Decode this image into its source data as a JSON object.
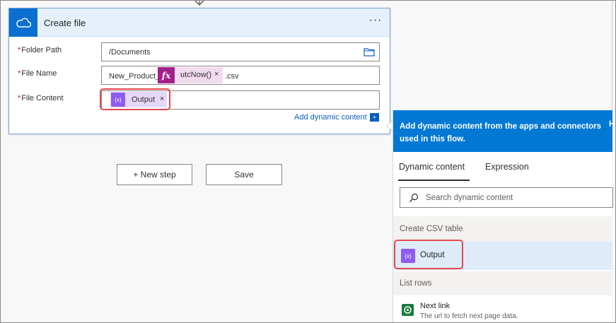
{
  "card": {
    "title": "Create file",
    "more": "···",
    "folder_label": "Folder Path",
    "folder_value": "/Documents",
    "filename_label": "File Name",
    "filename_prefix": "New_Product_",
    "filename_fx": "fx",
    "filename_token": "utcNow()",
    "filename_suffix": ".csv",
    "content_label": "File Content",
    "content_token": "Output",
    "token_close": "×",
    "required_mark": "*",
    "add_dynamic": "Add dynamic content"
  },
  "actions": {
    "new_step": "+ New step",
    "save": "Save"
  },
  "panel": {
    "header": "Add dynamic content from the apps and connectors used in this flow.",
    "header_cut": "H",
    "tabs": [
      "Dynamic content",
      "Expression"
    ],
    "search_placeholder": "Search dynamic content",
    "section_csv": "Create CSV table",
    "output_label": "Output",
    "section_list": "List rows",
    "next_title": "Next link",
    "next_desc": "The url to fetch next page data."
  },
  "icons": {
    "var_glyph": "{x}"
  },
  "colors": {
    "accent": "#0078d4",
    "fx": "#a3208b",
    "variable": "#8f5bf0",
    "highlight": "#e5484d"
  }
}
